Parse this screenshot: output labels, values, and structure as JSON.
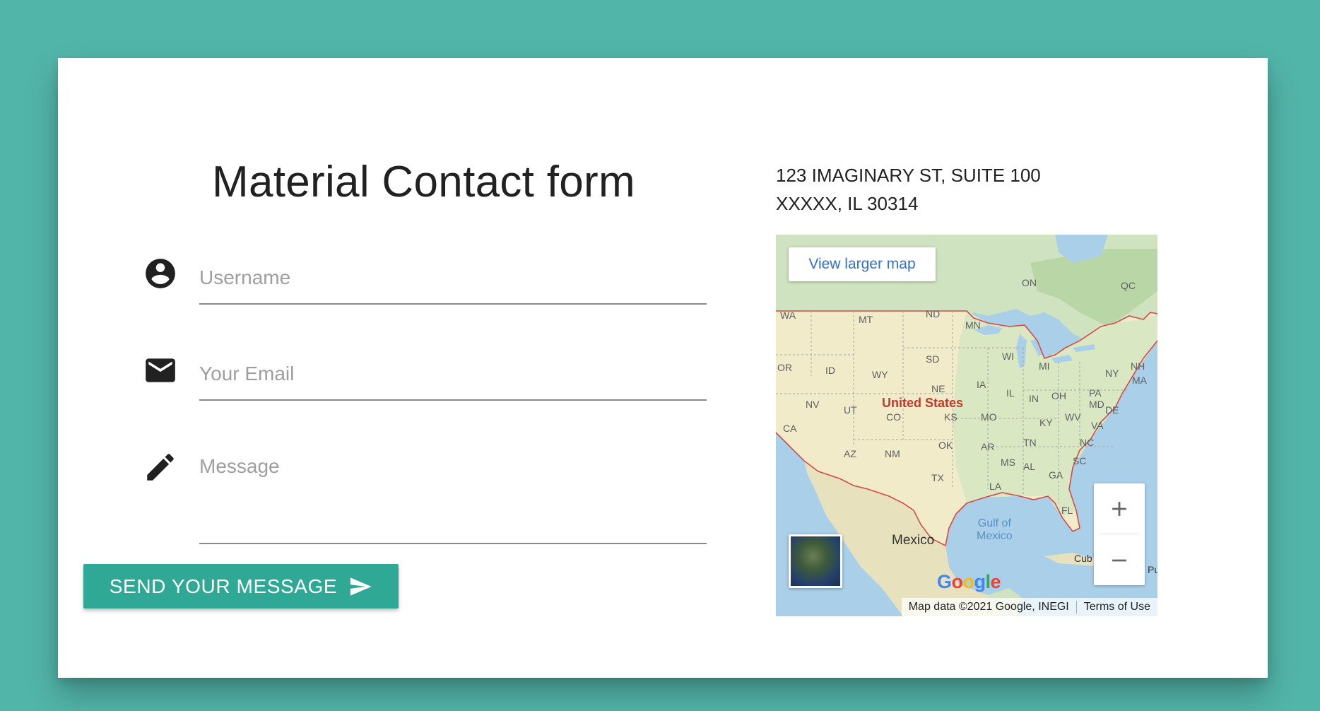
{
  "form": {
    "title": "Material Contact form",
    "username_placeholder": "Username",
    "email_placeholder": "Your Email",
    "message_placeholder": "Message",
    "send_label": "SEND YOUR MESSAGE"
  },
  "icons": {
    "username": "account-circle-icon",
    "email": "email-icon",
    "message": "pencil-icon",
    "send": "send-icon"
  },
  "address": {
    "line1": "123 IMAGINARY ST, SUITE 100",
    "line2": "XXXXX, IL 30314"
  },
  "map": {
    "view_larger": "View larger map",
    "country_label": "United States",
    "mexico_label": "Mexico",
    "gulf_label_1": "Gulf of",
    "gulf_label_2": "Mexico",
    "cuba_label": "Cub",
    "pr_label": "Pu",
    "states": {
      "wa": "WA",
      "mt": "MT",
      "nd": "ND",
      "mn": "MN",
      "on": "ON",
      "qc": "QC",
      "or": "OR",
      "id": "ID",
      "wy": "WY",
      "sd": "SD",
      "wi": "WI",
      "mi": "MI",
      "ny": "NY",
      "nh": "NH",
      "ma": "MA",
      "nv": "NV",
      "ut": "UT",
      "ne": "NE",
      "ia": "IA",
      "il": "IL",
      "in": "IN",
      "oh": "OH",
      "pa": "PA",
      "co": "CO",
      "ks": "KS",
      "mo": "MO",
      "ky": "KY",
      "wv": "WV",
      "md": "MD",
      "de": "DE",
      "va": "VA",
      "ca": "CA",
      "ok": "OK",
      "ar": "AR",
      "tn": "TN",
      "nc": "NC",
      "az": "AZ",
      "nm": "NM",
      "ms": "MS",
      "al": "AL",
      "sc": "SC",
      "ga": "GA",
      "tx": "TX",
      "la": "LA",
      "fl": "FL"
    },
    "logo_text": "Google",
    "attribution": "Map data ©2021 Google, INEGI",
    "terms": "Terms of Use",
    "zoom_in_icon": "plus-icon",
    "zoom_out_icon": "minus-icon"
  },
  "colors": {
    "background": "#52b5a9",
    "accent": "#2fa896",
    "card": "#ffffff"
  }
}
